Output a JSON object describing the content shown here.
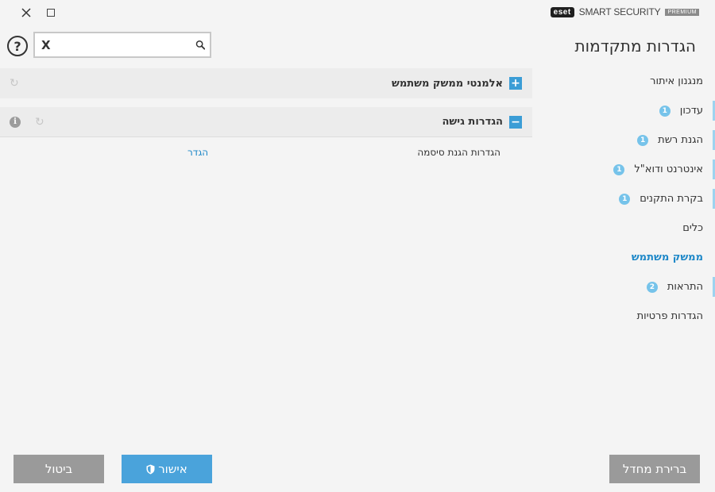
{
  "brand": {
    "logo": "eset",
    "name": "SMART SECURITY",
    "edition": "PREMIUM"
  },
  "window_controls": {
    "close_icon": "close-icon",
    "maximize_icon": "maximize-icon"
  },
  "page": {
    "title": "הגדרות מתקדמות"
  },
  "search": {
    "value": "",
    "placeholder": "",
    "clear_glyph": "X"
  },
  "help": {
    "glyph": "?"
  },
  "sidebar": {
    "items": [
      {
        "label": "מנגנון איתור",
        "badge": ""
      },
      {
        "label": "עדכון",
        "badge": "1"
      },
      {
        "label": "הגנת רשת",
        "badge": "1"
      },
      {
        "label": "אינטרנט ודוא\"ל",
        "badge": "1"
      },
      {
        "label": "בקרת התקנים",
        "badge": "1"
      },
      {
        "label": "כלים",
        "badge": ""
      },
      {
        "label": "ממשק משתמש",
        "badge": "",
        "active": true
      },
      {
        "label": "התראות",
        "badge": "2"
      },
      {
        "label": "הגדרות פרטיות",
        "badge": ""
      }
    ]
  },
  "sections": [
    {
      "title": "אלמנטי ממשק משתמש",
      "expander": "+"
    },
    {
      "title": "הגדרות גישה",
      "expander": "−"
    }
  ],
  "settings": {
    "password_label": "הגדרות הגנת סיסמה",
    "password_link": "הגדר"
  },
  "info_glyph": "i",
  "buttons": {
    "ok": "אישור",
    "cancel": "ביטול",
    "default": "ברירת מחדל"
  },
  "colors": {
    "accent": "#4aa3db",
    "link": "#1e88c8",
    "badge": "#76c3ea",
    "gray_button": "#9a9a9a"
  }
}
